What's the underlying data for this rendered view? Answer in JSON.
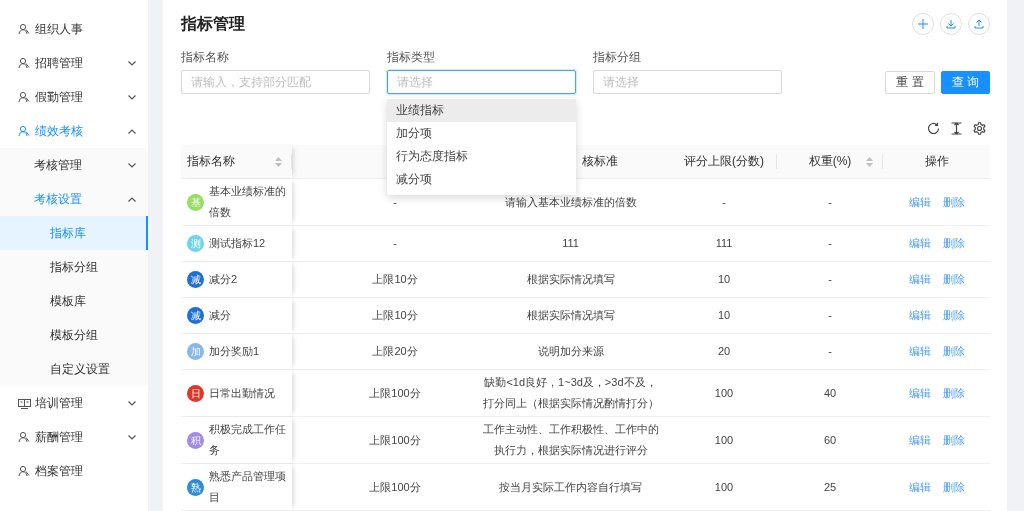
{
  "sidebar": {
    "items": [
      {
        "label": "组织人事",
        "kind": "person",
        "selected": false
      },
      {
        "label": "招聘管理",
        "kind": "person",
        "selected": false,
        "expanded": false
      },
      {
        "label": "假勤管理",
        "kind": "person",
        "selected": false,
        "expanded": false
      },
      {
        "label": "绩效考核",
        "kind": "person",
        "selected": true,
        "expanded": true,
        "children": [
          {
            "label": "考核管理",
            "selected": false,
            "expanded": false
          },
          {
            "label": "考核设置",
            "selected": true,
            "expanded": true,
            "children": [
              {
                "label": "指标库",
                "selected": true
              },
              {
                "label": "指标分组",
                "selected": false
              },
              {
                "label": "模板库",
                "selected": false
              },
              {
                "label": "模板分组",
                "selected": false
              },
              {
                "label": "自定义设置",
                "selected": false
              }
            ]
          }
        ]
      },
      {
        "label": "培训管理",
        "kind": "board",
        "selected": false,
        "expanded": false
      },
      {
        "label": "薪酬管理",
        "kind": "person",
        "selected": false,
        "expanded": false
      },
      {
        "label": "档案管理",
        "kind": "person",
        "selected": false
      }
    ]
  },
  "header": {
    "title": "指标管理"
  },
  "filters": {
    "fields": [
      {
        "label": "指标名称",
        "placeholder": "请输入，支持部分匹配",
        "focused": false
      },
      {
        "label": "指标类型",
        "placeholder": "请选择",
        "focused": true
      },
      {
        "label": "指标分组",
        "placeholder": "请选择",
        "focused": false
      }
    ],
    "buttons": [
      {
        "label": "重 置",
        "primary": false
      },
      {
        "label": "查 询",
        "primary": true
      }
    ],
    "dropdown": [
      {
        "label": "业绩指标",
        "active": true
      },
      {
        "label": "加分项",
        "active": false
      },
      {
        "label": "行为态度指标",
        "active": false
      },
      {
        "label": "减分项",
        "active": false
      }
    ]
  },
  "table": {
    "columns": [
      {
        "label": "指标名称",
        "sortable": true
      },
      {
        "label": "核标准",
        "sortable": false
      },
      {
        "label": "评分上限(分数)",
        "sortable": false
      },
      {
        "label": "权重(%)",
        "sortable": true
      },
      {
        "label": "操作",
        "sortable": false
      }
    ],
    "rows": [
      {
        "avatar": "基",
        "color": "#95de64",
        "name": "基本业绩标准的倍数",
        "limit": "-",
        "criteria": "请输入基本业绩标准的倍数",
        "score": "-",
        "weight": "-",
        "actions": [
          "编辑",
          "删除"
        ]
      },
      {
        "avatar": "测",
        "color": "#6fd3f0",
        "name": "测试指标12",
        "limit": "-",
        "criteria": "111",
        "score": "111",
        "weight": "-",
        "actions": [
          "编辑",
          "删除"
        ]
      },
      {
        "avatar": "减",
        "color": "#1f6fd6",
        "name": "减分2",
        "limit": "上限10分",
        "criteria": "根据实际情况填写",
        "score": "10",
        "weight": "-",
        "actions": [
          "编辑",
          "删除"
        ]
      },
      {
        "avatar": "减",
        "color": "#1f6fd6",
        "name": "减分",
        "limit": "上限10分",
        "criteria": "根据实际情况填写",
        "score": "10",
        "weight": "-",
        "actions": [
          "编辑",
          "删除"
        ]
      },
      {
        "avatar": "加",
        "color": "#86b8ee",
        "name": "加分奖励1",
        "limit": "上限20分",
        "criteria": "说明加分来源",
        "score": "20",
        "weight": "-",
        "actions": [
          "编辑",
          "删除"
        ]
      },
      {
        "avatar": "日",
        "color": "#e3362b",
        "name": "日常出勤情况",
        "limit": "上限100分",
        "criteria": "缺勤<1d良好，1~3d及，>3d不及，打分同上（根据实际情况酌情打分）",
        "score": "100",
        "weight": "40",
        "actions": [
          "编辑",
          "删除"
        ]
      },
      {
        "avatar": "积",
        "color": "#a28be6",
        "name": "积极完成工作任务",
        "limit": "上限100分",
        "criteria": "工作主动性、工作积极性、工作中的执行力，根据实际情况进行评分",
        "score": "100",
        "weight": "60",
        "actions": [
          "编辑",
          "删除"
        ]
      },
      {
        "avatar": "熟",
        "color": "#2f8ad8",
        "name": "熟悉产品管理项目",
        "limit": "上限100分",
        "criteria": "按当月实际工作内容自行填写",
        "score": "100",
        "weight": "25",
        "actions": [
          "编辑",
          "删除"
        ]
      }
    ]
  }
}
